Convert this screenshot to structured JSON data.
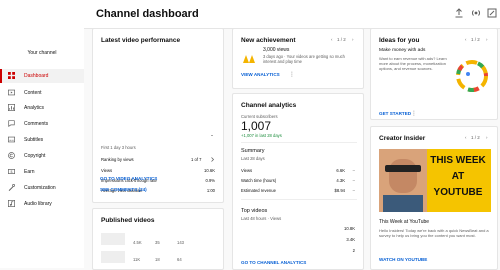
{
  "sidebar": {
    "title": "Your channel",
    "items": [
      {
        "label": "Dashboard",
        "icon": "dashboard-icon"
      },
      {
        "label": "Content",
        "icon": "content-icon"
      },
      {
        "label": "Analytics",
        "icon": "analytics-icon"
      },
      {
        "label": "Comments",
        "icon": "comments-icon"
      },
      {
        "label": "Subtitles",
        "icon": "subtitles-icon"
      },
      {
        "label": "Copyright",
        "icon": "copyright-icon"
      },
      {
        "label": "Earn",
        "icon": "earn-icon"
      },
      {
        "label": "Customization",
        "icon": "customization-icon"
      },
      {
        "label": "Audio library",
        "icon": "audio-library-icon"
      }
    ]
  },
  "header": {
    "title": "Channel dashboard"
  },
  "latest": {
    "title": "Latest video performance",
    "first_period": "First 1 day 3 hours",
    "rows": [
      {
        "label": "Ranking by views",
        "value": "1 of 7"
      },
      {
        "label": "Views",
        "value": "10.6K"
      },
      {
        "label": "Impressions click-through rate",
        "value": "0.9%"
      },
      {
        "label": "Average view duration",
        "value": "1:00"
      }
    ],
    "link1": "GO TO VIDEO ANALYTICS",
    "link2": "SEE COMMENTS (24)"
  },
  "published": {
    "title": "Published videos",
    "stats": [
      "4.5K",
      "35",
      "143"
    ],
    "stats2": [
      "11K",
      "18",
      "64"
    ]
  },
  "achievement": {
    "title": "New achievement",
    "pager": "1 / 2",
    "headline": "3,000 views",
    "sub": "3 days ago · Your videos are getting so much interest and play time",
    "link": "VIEW ANALYTICS"
  },
  "analytics": {
    "title": "Channel analytics",
    "subs_label": "Current subscribers",
    "subs_value": "1,007",
    "subs_delta": "+1,007 in last 28 days",
    "summary_title": "Summary",
    "summary_period": "Last 28 days",
    "summary_rows": [
      {
        "label": "Views",
        "value": "6.6K"
      },
      {
        "label": "Watch time (hours)",
        "value": "4.3K"
      },
      {
        "label": "Estimated revenue",
        "value": "$8.94"
      }
    ],
    "top_title": "Top videos",
    "top_period": "Last 48 hours · Views",
    "top_values": [
      "10.8K",
      "3.4K",
      "2"
    ],
    "link": "GO TO CHANNEL ANALYTICS"
  },
  "ideas": {
    "title": "Ideas for you",
    "pager": "1 / 2",
    "headline": "Make money with ads",
    "body": "Want to earn revenue with ads? Learn more about the process, monetization options, and revenue sources.",
    "link": "GET STARTED"
  },
  "insider": {
    "title": "Creator Insider",
    "pager": "1 / 2",
    "thumb_text": [
      "THIS WEEK",
      "AT",
      "YOUTUBE"
    ],
    "video_title": "This Week at YouTube",
    "body": "Hello Insiders! Today we're back with a quick NewsBeat and a survey to help us bring you the content you want most.",
    "link": "WATCH ON YOUTUBE"
  },
  "colors": {
    "accent": "#cc0000",
    "link": "#065fd4",
    "green": "#1e8e3e"
  }
}
